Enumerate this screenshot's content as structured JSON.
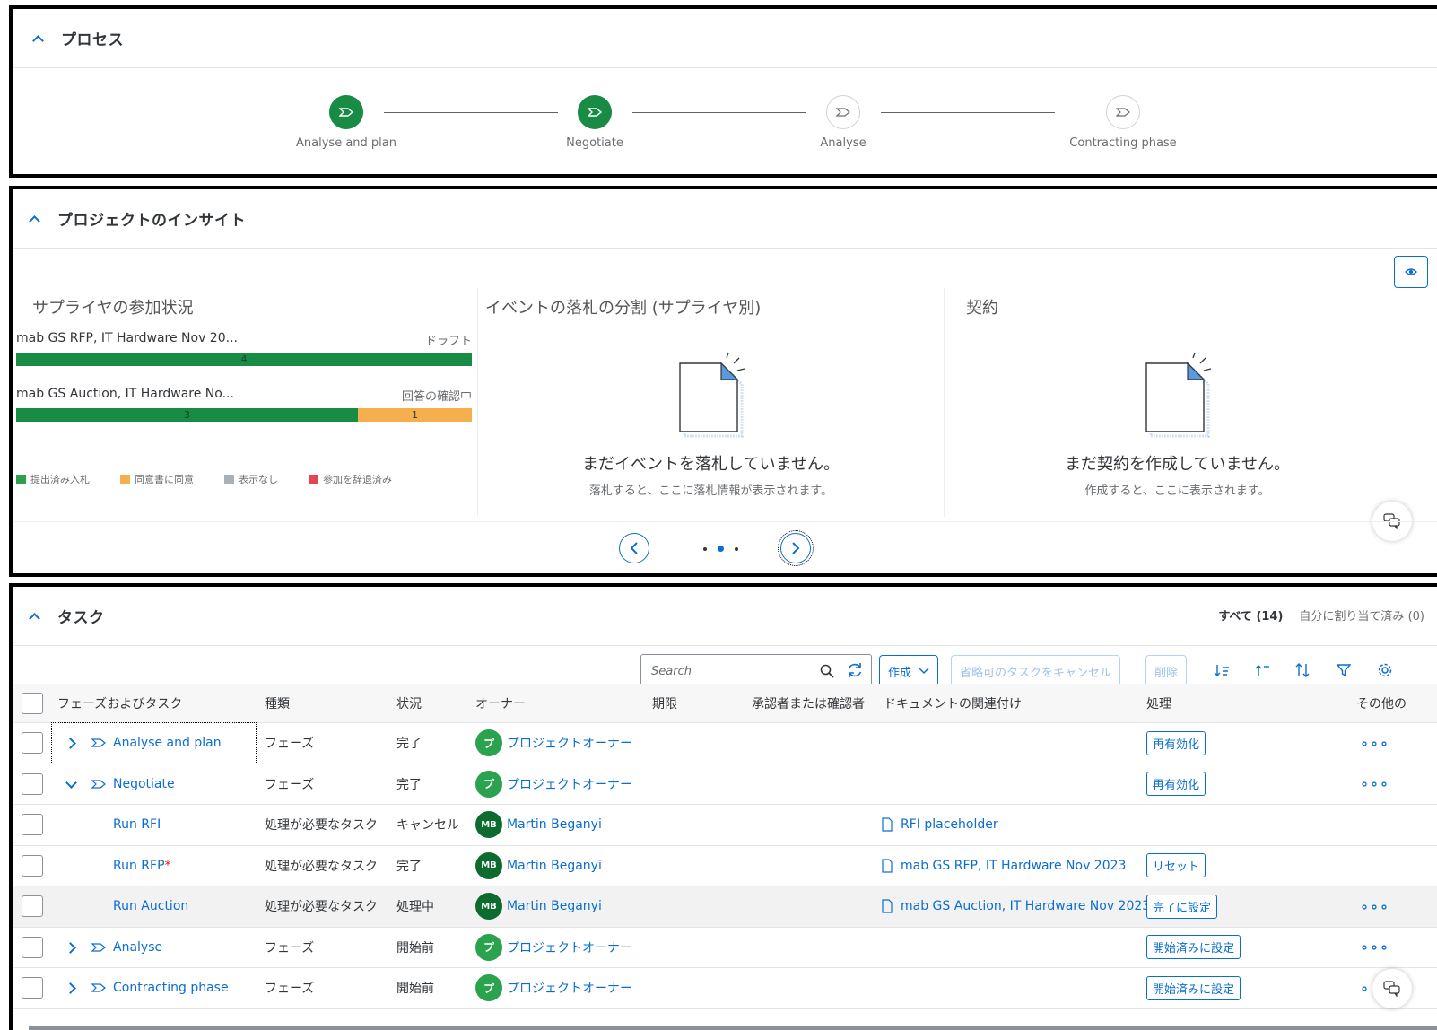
{
  "process": {
    "title": "プロセス",
    "steps": [
      {
        "label": "Analyse and plan",
        "state": "done"
      },
      {
        "label": "Negotiate",
        "state": "done"
      },
      {
        "label": "Analyse",
        "state": "todo"
      },
      {
        "label": "Contracting phase",
        "state": "todo"
      }
    ]
  },
  "insights": {
    "title": "プロジェクトのインサイト",
    "participation": {
      "title": "サプライヤの参加状況",
      "rows": [
        {
          "name": "mab GS RFP, IT Hardware Nov 20...",
          "status": "ドラフト",
          "segments": [
            {
              "value": "4",
              "fraction": 1.0,
              "color": "green"
            }
          ]
        },
        {
          "name": "mab GS Auction, IT Hardware No...",
          "status": "回答の確認中",
          "segments": [
            {
              "value": "3",
              "fraction": 0.75,
              "color": "green"
            },
            {
              "value": "1",
              "fraction": 0.25,
              "color": "orange"
            }
          ]
        }
      ],
      "legend": [
        {
          "label": "提出済み入札",
          "color": "#2e9e4f"
        },
        {
          "label": "同意書に同意",
          "color": "#f5b04d"
        },
        {
          "label": "表示なし",
          "color": "#a9b0b6"
        },
        {
          "label": "参加を辞退済み",
          "color": "#e34552"
        }
      ]
    },
    "award": {
      "title": "イベントの落札の分割 (サプライヤ別)",
      "empty_title": "まだイベントを落札していません。",
      "empty_sub": "落札すると、ここに落札情報が表示されます。"
    },
    "contracts": {
      "title": "契約",
      "empty_title": "まだ契約を作成していません。",
      "empty_sub": "作成すると、ここに表示されます。"
    },
    "carousel": {
      "page": 2,
      "pages": 3
    }
  },
  "tasks": {
    "title": "タスク",
    "tabs": [
      {
        "label": "すべて",
        "count": "(14)",
        "selected": true
      },
      {
        "label": "自分に割り当て済み",
        "count": "(0)",
        "selected": false
      }
    ],
    "search_placeholder": "Search",
    "create_label": "作成",
    "cancel_optional_label": "省略可のタスクをキャンセル",
    "delete_label": "削除",
    "columns": {
      "phase_task": "フェーズおよびタスク",
      "type": "種類",
      "status": "状況",
      "owner": "オーナー",
      "due": "期限",
      "approver": "承認者または確認者",
      "docs": "ドキュメントの関連付け",
      "action": "処理",
      "other": "その他の"
    },
    "rows": [
      {
        "level": 0,
        "expander": "right",
        "name": "Analyse and plan",
        "type": "フェーズ",
        "status": "完了",
        "owner_initial": "プ",
        "owner": "プロジェクトオーナー",
        "doc": "",
        "action": "再有効化",
        "more": "∘∘∘"
      },
      {
        "level": 0,
        "expander": "down",
        "name": "Negotiate",
        "type": "フェーズ",
        "status": "完了",
        "owner_initial": "プ",
        "owner": "プロジェクトオーナー",
        "doc": "",
        "action": "再有効化",
        "more": "∘∘∘"
      },
      {
        "level": 1,
        "name": "Run RFI",
        "type": "処理が必要なタスク",
        "status": "キャンセル",
        "owner_initial": "MB",
        "owner": "Martin Beganyi",
        "doc": "RFI placeholder",
        "action": "",
        "more": ""
      },
      {
        "level": 1,
        "name": "Run RFP",
        "required": "*",
        "type": "処理が必要なタスク",
        "status": "完了",
        "owner_initial": "MB",
        "owner": "Martin Beganyi",
        "doc": "mab GS RFP, IT Hardware Nov 2023",
        "action": "リセット",
        "more": ""
      },
      {
        "level": 1,
        "name": "Run Auction",
        "type": "処理が必要なタスク",
        "status": "処理中",
        "owner_initial": "MB",
        "owner": "Martin Beganyi",
        "doc": "mab GS Auction, IT Hardware Nov 2023",
        "action": "完了に設定",
        "more": "∘∘∘"
      },
      {
        "level": 0,
        "expander": "right",
        "name": "Analyse",
        "type": "フェーズ",
        "status": "開始前",
        "owner_initial": "プ",
        "owner": "プロジェクトオーナー",
        "doc": "",
        "action": "開始済みに設定",
        "more": "∘∘∘"
      },
      {
        "level": 0,
        "expander": "right",
        "name": "Contracting phase",
        "type": "フェーズ",
        "status": "開始前",
        "owner_initial": "プ",
        "owner": "プロジェクトオーナー",
        "doc": "",
        "action": "開始済みに設定",
        "more": "∘"
      }
    ]
  }
}
